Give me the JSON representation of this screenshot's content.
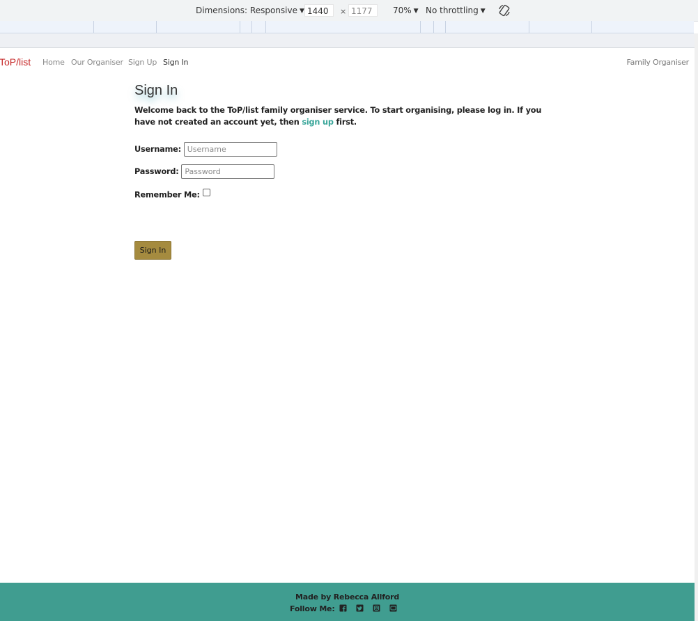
{
  "devtools": {
    "dimensions_label": "Dimensions: Responsive",
    "width": "1440",
    "times": "×",
    "height": "1177",
    "zoom": "70%",
    "throttling": "No throttling"
  },
  "navbar": {
    "brand": "ToP/list",
    "links": [
      "Home",
      "Our Organiser",
      "Sign Up",
      "Sign In"
    ],
    "right": "Family Organiser"
  },
  "page": {
    "title": "Sign In",
    "intro_before": "Welcome back to the ToP/list family organiser service. To start organising, please log in. If you have not created an account yet, then ",
    "intro_link": "sign up",
    "intro_after": " first."
  },
  "form": {
    "username_label": "Username:",
    "username_placeholder": "Username",
    "password_label": "Password:",
    "password_placeholder": "Password",
    "remember_label": "Remember Me:",
    "remember_checked": false,
    "submit_label": "Sign In"
  },
  "footer": {
    "made_by": "Made by Rebecca Allford",
    "follow_label": "Follow Me:",
    "social_icons": [
      "facebook-icon",
      "twitter-icon",
      "instagram-icon",
      "youtube-icon"
    ]
  },
  "colors": {
    "brand": "#c62828",
    "link": "#3aa69a",
    "button": "#a58b3f",
    "footer": "#409d90"
  }
}
